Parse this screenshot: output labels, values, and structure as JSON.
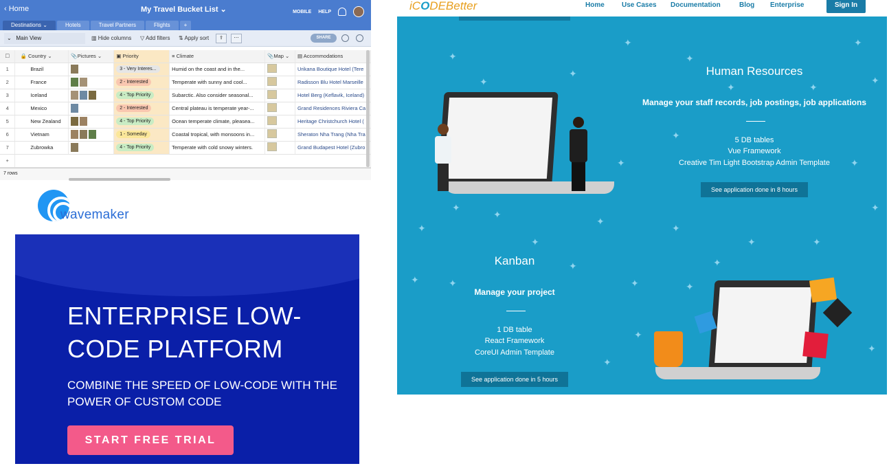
{
  "airtable": {
    "back_label": "Home",
    "title": "My Travel Bucket List",
    "top_right": {
      "mobile": "MOBILE",
      "help": "HELP"
    },
    "tabs": [
      {
        "label": "Destinations",
        "active": true
      },
      {
        "label": "Hotels",
        "active": false
      },
      {
        "label": "Travel Partners",
        "active": false
      },
      {
        "label": "Flights",
        "active": false
      },
      {
        "label": "+",
        "active": false
      }
    ],
    "view": {
      "name": "Main View",
      "hide_columns": "Hide columns",
      "add_filters": "Add filters",
      "apply_sort": "Apply sort",
      "share": "SHARE"
    },
    "columns": [
      "Country",
      "Pictures",
      "Priority",
      "Climate",
      "Map",
      "Accommodations"
    ],
    "rows": [
      {
        "num": "1",
        "country": "Brazil",
        "priority": "3 - Very Interes...",
        "priority_color": "#e6e6e6",
        "climate": "Humid on the coast and in the...",
        "accom": "Urikana Boutique Hotel (Tere"
      },
      {
        "num": "2",
        "country": "France",
        "priority": "2 - Interested",
        "priority_color": "#f9c7b0",
        "climate": "Temperate with sunny and cool...",
        "accom": "Radisson Blu Hotel Marseille"
      },
      {
        "num": "3",
        "country": "Iceland",
        "priority": "4 - Top Priority",
        "priority_color": "#c9ecc4",
        "climate": "Subarctic. Also consider seasonal...",
        "accom": "Hotel Berg (Keflavik, Iceland)"
      },
      {
        "num": "4",
        "country": "Mexico",
        "priority": "2 - Interested",
        "priority_color": "#f9c7b0",
        "climate": "Central plateau is temperate year-...",
        "accom": "Grand Residences Riviera Ca"
      },
      {
        "num": "5",
        "country": "New Zealand",
        "priority": "4 - Top Priority",
        "priority_color": "#c9ecc4",
        "climate": "Ocean temperate climate, pleasea...",
        "accom": "Heritage Christchurch Hotel ("
      },
      {
        "num": "6",
        "country": "Vietnam",
        "priority": "1 - Someday",
        "priority_color": "#fbe79a",
        "climate": "Coastal tropical, with monsoons in...",
        "accom": "Sheraton Nha Trang (Nha Tra"
      },
      {
        "num": "7",
        "country": "Zubrowka",
        "priority": "4 - Top Priority",
        "priority_color": "#c9ecc4",
        "climate": "Temperate with cold snowy winters.",
        "accom": "Grand Budapest Hotel (Zubro"
      }
    ],
    "add_row": "+",
    "footer": "7 rows"
  },
  "wavemaker": {
    "logo_text": "wavemaker",
    "headline": "ENTERPRISE LOW-CODE PLATFORM",
    "subhead": "COMBINE THE SPEED OF LOW-CODE WITH THE POWER OF CUSTOM CODE",
    "cta": "START FREE TRIAL",
    "colors": {
      "bg": "#0a1fa8",
      "cta": "#f35a8a",
      "logo": "#2196f3"
    }
  },
  "icodebetter": {
    "logo": {
      "prefix": "iC",
      "middle": "O",
      "suffix": "DE",
      "tail": "Better"
    },
    "nav": [
      "Home",
      "Use Cases",
      "Documentation",
      "Blog",
      "Enterprise"
    ],
    "signin": "Sign In",
    "sections": [
      {
        "title": "Human Resources",
        "subtitle": "Manage your staff records, job postings, job applications",
        "lines": [
          "5 DB tables",
          "Vue Framework",
          "Creative Tim Light Bootstrap Admin Template"
        ],
        "cta": "See application done in 8 hours"
      },
      {
        "title": "Kanban",
        "subtitle": "Manage your project",
        "lines": [
          "1 DB table",
          "React Framework",
          "CoreUI Admin Template"
        ],
        "cta": "See application done in 5 hours"
      }
    ],
    "colors": {
      "bg": "#1a9dc8",
      "cta": "#0f7397",
      "nav_text": "#1a7ca7"
    }
  }
}
